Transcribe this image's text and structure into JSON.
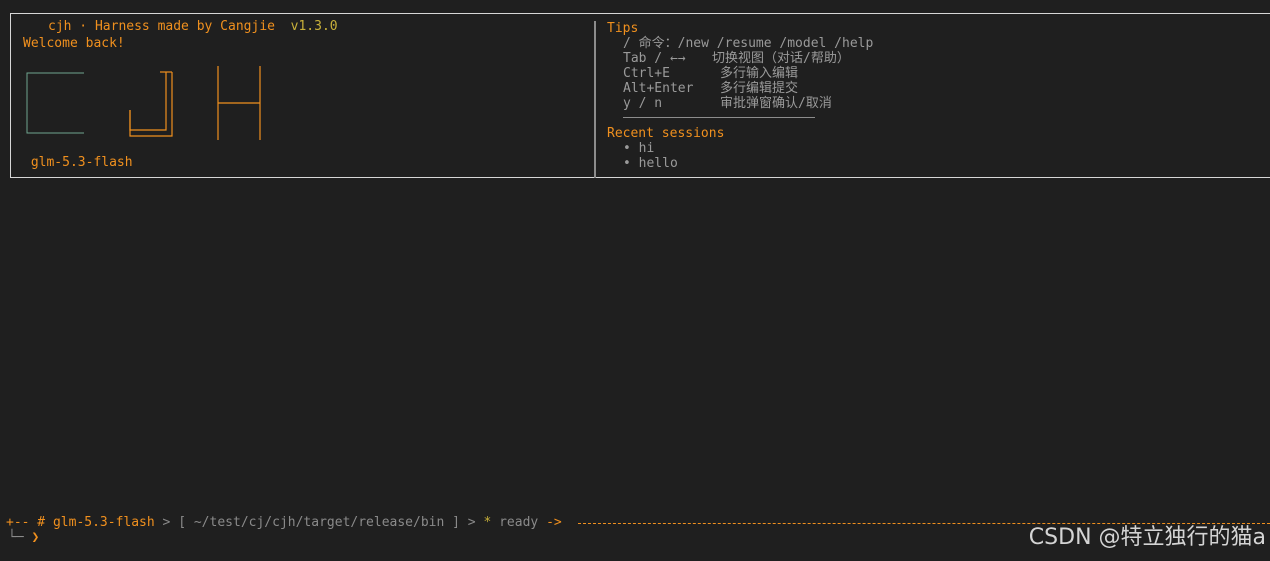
{
  "panel": {
    "title_name": "cjh · Harness made by Cangjie",
    "version": "v1.3.0"
  },
  "left": {
    "welcome": "Welcome back!",
    "logo_text": "CJH",
    "model_icon": "",
    "model": "glm-5.3-flash"
  },
  "tips": {
    "title": "Tips",
    "command_hint": "/ 命令：/new /resume /model /help",
    "rows": [
      {
        "key": "Tab / ←→",
        "desc": "切换视图（对话/帮助）"
      },
      {
        "key": "Ctrl+E",
        "desc": "多行输入编辑"
      },
      {
        "key": "Alt+Enter",
        "desc": "多行编辑提交"
      },
      {
        "key": "y / n",
        "desc": "审批弹窗确认/取消"
      }
    ]
  },
  "recent": {
    "title": "Recent sessions",
    "items": [
      "• hi",
      "• hello"
    ]
  },
  "statusbar": {
    "prefix": "+-- # ",
    "model": "glm-5.3-flash",
    "sep1": " > ",
    "path": "[ ~/test/cj/cjh/target/release/bin ]",
    "sep2": " > ",
    "star": "* ",
    "state": "ready",
    "arrow": " ->"
  },
  "prompt": {
    "corner": "└─",
    "symbol": "❯"
  },
  "watermark": "CSDN @特立独行的猫a",
  "colors": {
    "background": "#1f1f1f",
    "accent": "#f0901e",
    "logo_c": "#6fa58f",
    "text": "#9a9a9a"
  }
}
